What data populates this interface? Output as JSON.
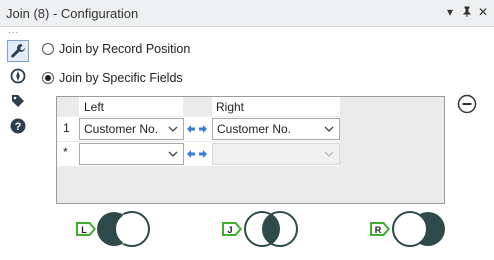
{
  "window": {
    "title": "Join (8) - Configuration",
    "controls": {
      "menu": "▾",
      "pin": "ᵸ",
      "close": "✕"
    },
    "overflow_dots": "..."
  },
  "sidebar": {
    "tools": [
      {
        "name": "wrench-icon",
        "active": true
      },
      {
        "name": "compass-icon",
        "active": false
      },
      {
        "name": "tag-icon",
        "active": false
      },
      {
        "name": "help-icon",
        "active": false
      }
    ]
  },
  "options": {
    "by_position": {
      "label": "Join by Record Position",
      "selected": false
    },
    "by_fields": {
      "label": "Join by Specific Fields",
      "selected": true
    }
  },
  "grid": {
    "columns": {
      "left": "Left",
      "right": "Right"
    },
    "rows": [
      {
        "num": "1",
        "left": "Customer No.",
        "right": "Customer No.",
        "right_enabled": true
      },
      {
        "num": "*",
        "left": "",
        "right": "",
        "right_enabled": false
      }
    ]
  },
  "outputs": [
    {
      "letter": "L",
      "name": "left-output"
    },
    {
      "letter": "J",
      "name": "join-output"
    },
    {
      "letter": "R",
      "name": "right-output"
    }
  ],
  "colors": {
    "accent": "#2e4a4a",
    "anchor_green": "#3fae2a",
    "arrow_blue": "#3a7bd5"
  }
}
